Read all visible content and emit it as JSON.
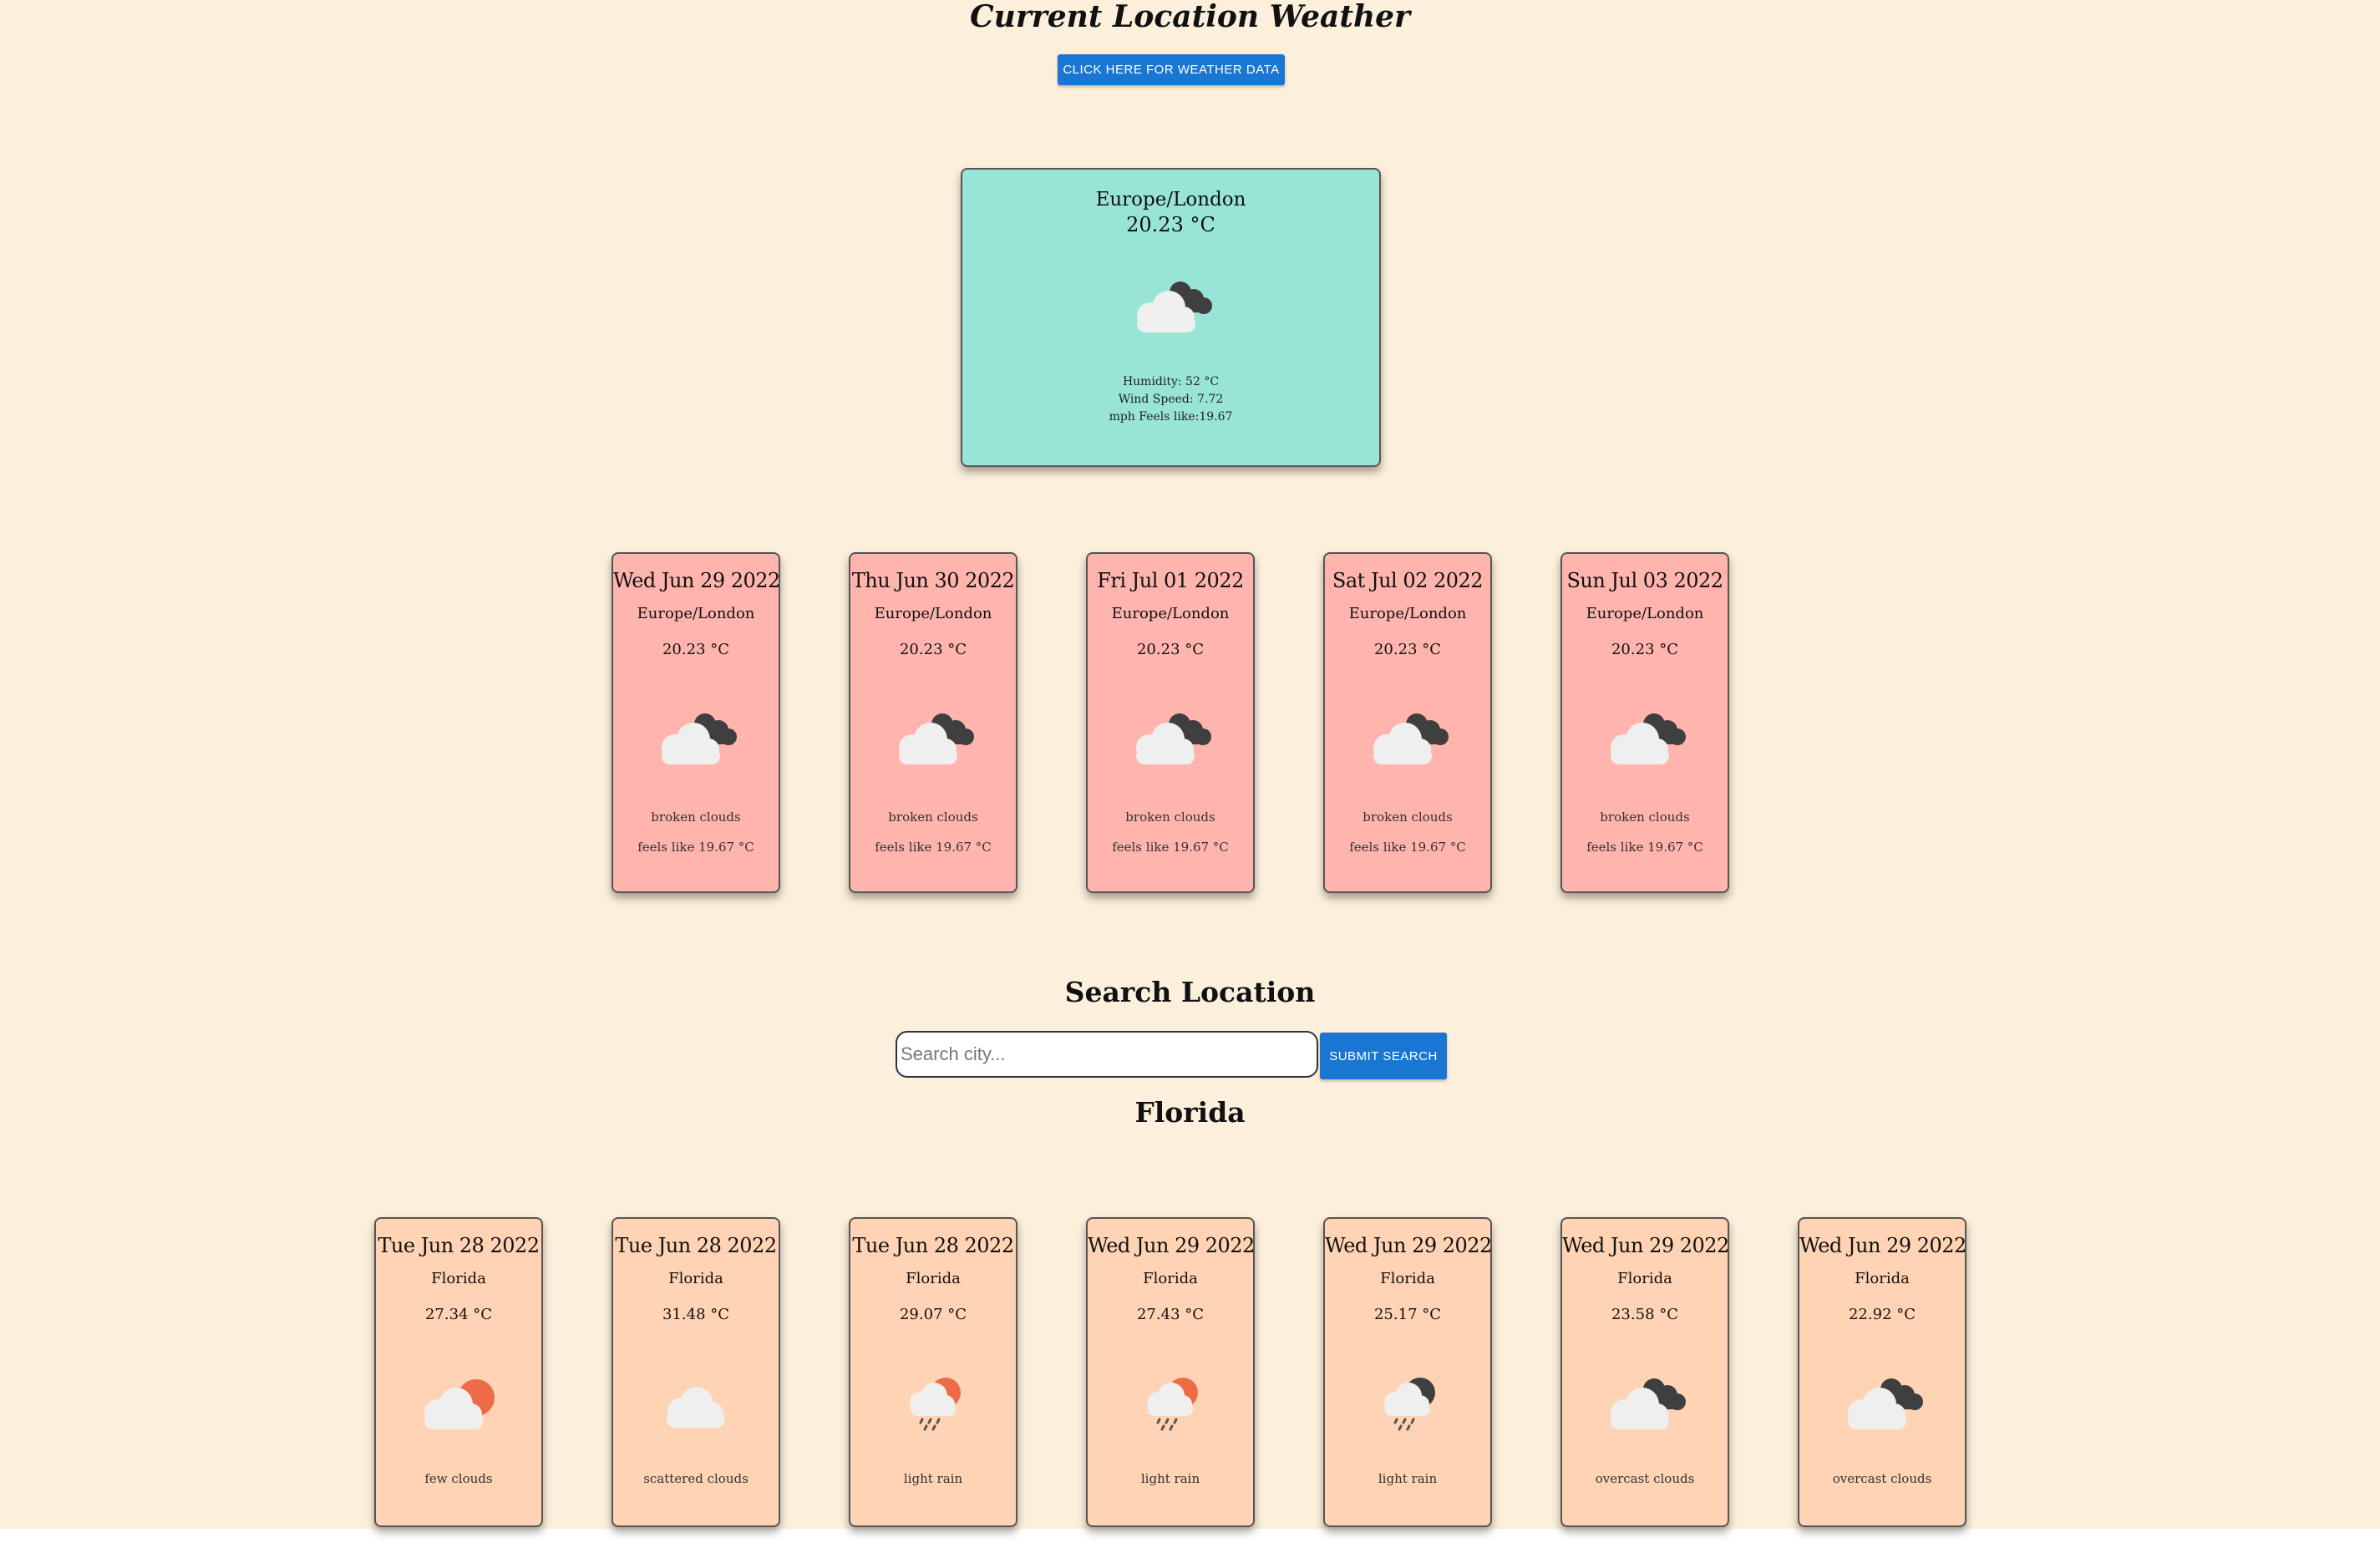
{
  "page": {
    "title": "Current Location Weather",
    "weather_button": "CLICK HERE FOR WEATHER DATA"
  },
  "current": {
    "location": "Europe/London",
    "temperature": "20.23 °C",
    "icon": "broken-clouds-icon",
    "details_line1": "Humidity: 52 °C",
    "details_line2": "Wind Speed: 7.72",
    "details_line3": "mph Feels like:19.67"
  },
  "forecast": [
    {
      "date": "Wed Jun 29 2022",
      "location": "Europe/London",
      "temperature": "20.23 °C",
      "icon": "broken-clouds",
      "description": "broken clouds",
      "feels": "feels like 19.67 °C"
    },
    {
      "date": "Thu Jun 30 2022",
      "location": "Europe/London",
      "temperature": "20.23 °C",
      "icon": "broken-clouds",
      "description": "broken clouds",
      "feels": "feels like 19.67 °C"
    },
    {
      "date": "Fri Jul 01 2022",
      "location": "Europe/London",
      "temperature": "20.23 °C",
      "icon": "broken-clouds",
      "description": "broken clouds",
      "feels": "feels like 19.67 °C"
    },
    {
      "date": "Sat Jul 02 2022",
      "location": "Europe/London",
      "temperature": "20.23 °C",
      "icon": "broken-clouds",
      "description": "broken clouds",
      "feels": "feels like 19.67 °C"
    },
    {
      "date": "Sun Jul 03 2022",
      "location": "Europe/London",
      "temperature": "20.23 °C",
      "icon": "broken-clouds",
      "description": "broken clouds",
      "feels": "feels like 19.67 °C"
    }
  ],
  "search": {
    "heading": "Search Location",
    "placeholder": "Search city...",
    "value": "",
    "submit_label": "SUBMIT SEARCH"
  },
  "city": {
    "name": "Florida",
    "cards": [
      {
        "date": "Tue Jun 28 2022",
        "location": "Florida",
        "temperature": "27.34 °C",
        "icon": "few-clouds-day",
        "description": "few clouds"
      },
      {
        "date": "Tue Jun 28 2022",
        "location": "Florida",
        "temperature": "31.48 °C",
        "icon": "scattered-clouds",
        "description": "scattered clouds"
      },
      {
        "date": "Tue Jun 28 2022",
        "location": "Florida",
        "temperature": "29.07 °C",
        "icon": "rain-day",
        "description": "light rain"
      },
      {
        "date": "Wed Jun 29 2022",
        "location": "Florida",
        "temperature": "27.43 °C",
        "icon": "rain-day",
        "description": "light rain"
      },
      {
        "date": "Wed Jun 29 2022",
        "location": "Florida",
        "temperature": "25.17 °C",
        "icon": "rain-night",
        "description": "light rain"
      },
      {
        "date": "Wed Jun 29 2022",
        "location": "Florida",
        "temperature": "23.58 °C",
        "icon": "broken-clouds",
        "description": "overcast clouds"
      },
      {
        "date": "Wed Jun 29 2022",
        "location": "Florida",
        "temperature": "22.92 °C",
        "icon": "broken-clouds",
        "description": "overcast clouds"
      }
    ]
  },
  "colors": {
    "background": "#fcefdb",
    "current_card": "#98e4d7",
    "forecast_card": "#ffb4ad",
    "city_card": "#ffd3b4",
    "button": "#1976d2",
    "sun": "#ef6b47",
    "dark_cloud": "#3f3f3f",
    "light_cloud": "#efefef"
  }
}
